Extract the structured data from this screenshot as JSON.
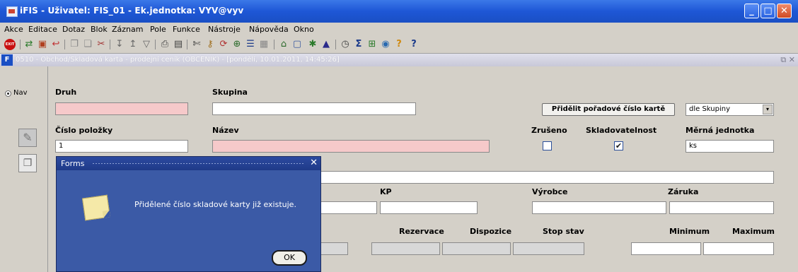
{
  "window": {
    "title": "iFIS - Uživatel: FIS_01 - Ek.jednotka: VYV@vyv",
    "minimize": "_",
    "maximize": "□",
    "close": "✕"
  },
  "menu": [
    "Akce",
    "Editace",
    "Dotaz",
    "Blok",
    "Záznam",
    "Pole",
    "Funkce",
    "Nástroje",
    "Nápověda",
    "Okno"
  ],
  "toolbar": {
    "exit_label": "EXIT",
    "icons": [
      "exit-icon",
      "save-icon",
      "folder-icon",
      "undo-icon",
      "copy-icon",
      "paste-icon",
      "cut-icon",
      "sort-asc-icon",
      "sort-desc-icon",
      "filter-icon",
      "print-icon",
      "preview-icon",
      "scissors-icon",
      "key-icon",
      "refresh-icon",
      "insert-row-icon",
      "list-icon",
      "table-icon",
      "lock-icon",
      "grid-icon",
      "star-icon",
      "triangle-icon",
      "check-circle-icon",
      "sum-icon",
      "calculator-icon",
      "globe-icon",
      "help-icon",
      "context-help-icon"
    ]
  },
  "form": {
    "title": "0510 - Obchod/Skladová karta - prodejní ceník (OBCENIK) - [pondělí, 10.01.2011, 14:45:26]",
    "window_controls": "⧉ ✕",
    "nav_label": "Nav",
    "labels": {
      "druh": "Druh",
      "skupina": "Skupina",
      "cislo_polozky": "Číslo položky",
      "nazev": "Název",
      "zruseno": "Zrušeno",
      "skladovatelnost": "Skladovatelnost",
      "merna_jednotka": "Měrná jednotka",
      "kp": "KP",
      "vyrobce": "Výrobce",
      "zaruka": "Záruka",
      "rezervace": "Rezervace",
      "dispozice": "Dispozice",
      "stop_stav": "Stop stav",
      "minimum": "Minimum",
      "maximum": "Maximum"
    },
    "values": {
      "druh": "",
      "skupina": "",
      "cislo_polozky": "1",
      "nazev": "",
      "merna_jednotka": "ks",
      "zruseno": false,
      "skladovatelnost": true
    },
    "assign_button": "Přidělit pořadové číslo kartě",
    "assign_select": "dle Skupiny"
  },
  "dialog": {
    "title": "Forms",
    "close": "✕",
    "message": "Přidělené číslo skladové karty již existuje.",
    "ok_label": "OK"
  }
}
